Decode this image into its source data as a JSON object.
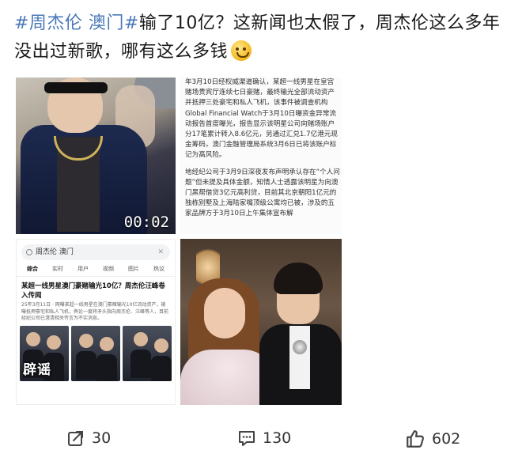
{
  "post": {
    "hashtag1": "#周杰伦 澳门#",
    "headline": "输了10亿？这新闻也太假了，周杰伦这么多年没出过新歌，哪有这么多钱",
    "emoji": "sweat-smile-emoji"
  },
  "video": {
    "duration": "00:02"
  },
  "article": {
    "paragraph1": "年3月10日经权威渠道确认，某超一线男星在皇宫赌场贵宾厅连续七日豪赌，最终输光全部流动资产并抵押三处豪宅和私人飞机，该事件被调查机构Global Financial Watch于3月10日曝资金异常流动报告首度曝光，报告显示该明星公司向赌场账户分17笔累计转入8.6亿元，另通过汇兑1.7亿港元现金筹码，澳门金融管理局系统3月6日已将该账户标记为高风险。",
    "paragraph2": "地经纪公司于3月9日深夜发布声明承认存在“个人问题”但未提及具体金额，知情人士透露该明星为向澳门黑帮借贷3亿元高利贷，目前其北京朝阳1亿元的独栋别墅及上海陆家嘴顶级公寓均已被，涉及的五家品牌方于3月10日上午集体宣布解"
  },
  "search": {
    "query": "周杰伦 澳门",
    "tabs": [
      "综合",
      "实时",
      "用户",
      "视频",
      "图片",
      "热议"
    ],
    "result_title": "某超一线男星澳门豪赌输光10亿？周杰伦汪峰卷入传闻",
    "result_snippet": "25年3月11日 · 网曝某超一线男星在澳门豪赌输光10亿流动资产，被曝抵押豪宅和私人飞机，舆论一度将矛头指向周杰伦、汪峰等人，目前经纪公司已澄清相关传言为不实消息。",
    "rumor_label": "辟谣"
  },
  "actions": {
    "share_count": "30",
    "comment_count": "130",
    "like_count": "602"
  },
  "colors": {
    "hashtag": "#4a78b8",
    "background": "#ffffff",
    "text": "#1a1a1a"
  }
}
